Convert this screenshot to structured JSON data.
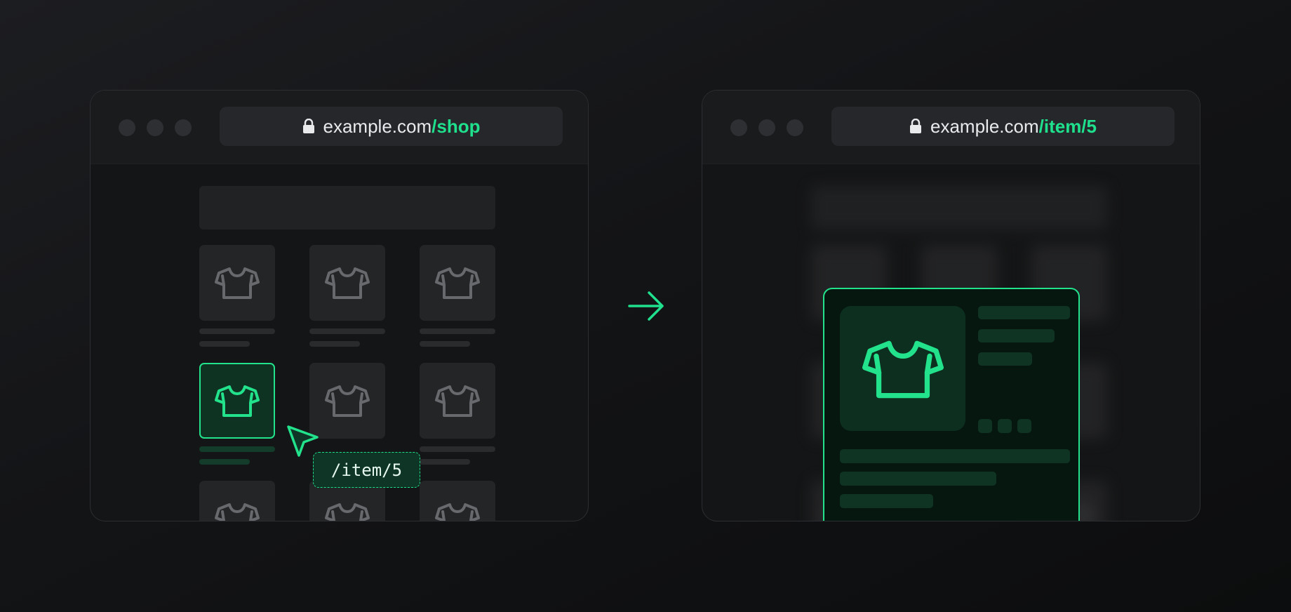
{
  "colors": {
    "accent": "#1fe08d",
    "background": "#131416",
    "tile": "#242527",
    "tile_icon": "#68696d"
  },
  "left_browser": {
    "url_domain": "example.com",
    "url_path": "/shop",
    "lock_icon": "lock-icon",
    "grid_item_icon": "tshirt-icon",
    "selected_item_index": 3,
    "link_preview": "/item/5",
    "cursor_icon": "cursor-arrow-icon"
  },
  "right_browser": {
    "url_domain": "example.com",
    "url_path": "/item/5",
    "lock_icon": "lock-icon",
    "modal_icon": "tshirt-icon"
  },
  "transition_icon": "arrow-right-icon"
}
